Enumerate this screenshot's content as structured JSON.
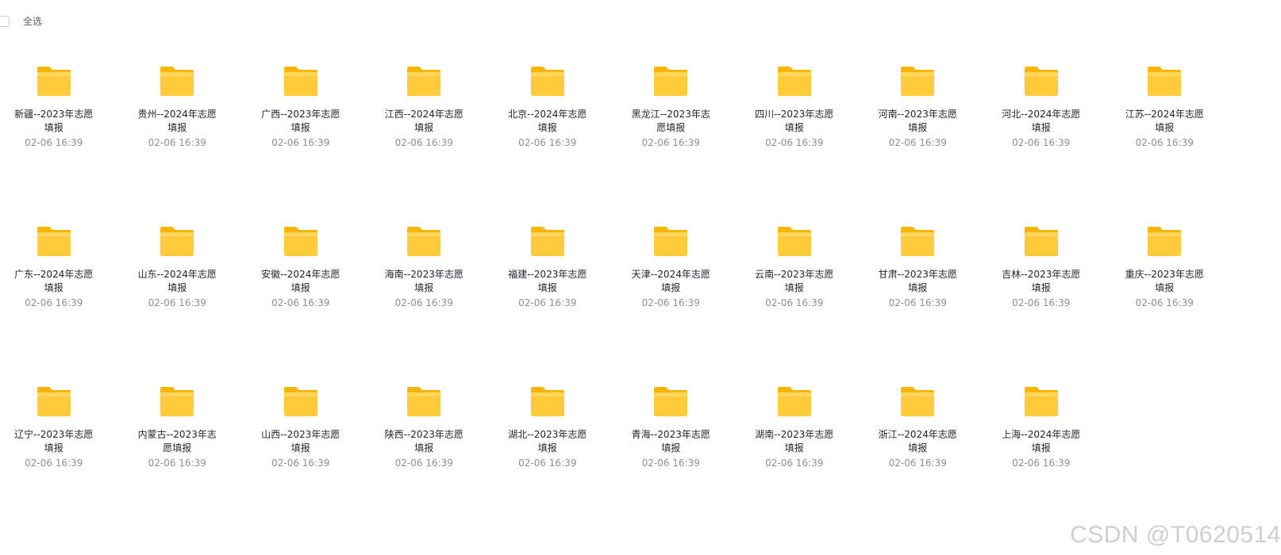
{
  "toolbar": {
    "select_all_label": "全选"
  },
  "folders": [
    {
      "name": "新疆--2023年志愿填报",
      "date": "02-06 16:39"
    },
    {
      "name": "贵州--2024年志愿填报",
      "date": "02-06 16:39"
    },
    {
      "name": "广西--2023年志愿填报",
      "date": "02-06 16:39"
    },
    {
      "name": "江西--2024年志愿填报",
      "date": "02-06 16:39"
    },
    {
      "name": "北京--2024年志愿填报",
      "date": "02-06 16:39"
    },
    {
      "name": "黑龙江--2023年志愿填报",
      "date": "02-06 16:39"
    },
    {
      "name": "四川--2023年志愿填报",
      "date": "02-06 16:39"
    },
    {
      "name": "河南--2023年志愿填报",
      "date": "02-06 16:39"
    },
    {
      "name": "河北--2024年志愿填报",
      "date": "02-06 16:39"
    },
    {
      "name": "江苏--2024年志愿填报",
      "date": "02-06 16:39"
    },
    {
      "name": "广东--2024年志愿填报",
      "date": "02-06 16:39"
    },
    {
      "name": "山东--2024年志愿填报",
      "date": "02-06 16:39"
    },
    {
      "name": "安徽--2024年志愿填报",
      "date": "02-06 16:39"
    },
    {
      "name": "海南--2023年志愿填报",
      "date": "02-06 16:39"
    },
    {
      "name": "福建--2023年志愿填报",
      "date": "02-06 16:39"
    },
    {
      "name": "天津--2024年志愿填报",
      "date": "02-06 16:39"
    },
    {
      "name": "云南--2023年志愿填报",
      "date": "02-06 16:39"
    },
    {
      "name": "甘肃--2023年志愿填报",
      "date": "02-06 16:39"
    },
    {
      "name": "吉林--2023年志愿填报",
      "date": "02-06 16:39"
    },
    {
      "name": "重庆--2023年志愿填报",
      "date": "02-06 16:39"
    },
    {
      "name": "辽宁--2023年志愿填报",
      "date": "02-06 16:39"
    },
    {
      "name": "内蒙古--2023年志愿填报",
      "date": "02-06 16:39"
    },
    {
      "name": "山西--2023年志愿填报",
      "date": "02-06 16:39"
    },
    {
      "name": "陕西--2023年志愿填报",
      "date": "02-06 16:39"
    },
    {
      "name": "湖北--2023年志愿填报",
      "date": "02-06 16:39"
    },
    {
      "name": "青海--2023年志愿填报",
      "date": "02-06 16:39"
    },
    {
      "name": "湖南--2023年志愿填报",
      "date": "02-06 16:39"
    },
    {
      "name": "浙江--2024年志愿填报",
      "date": "02-06 16:39"
    },
    {
      "name": "上海--2024年志愿填报",
      "date": "02-06 16:39"
    }
  ],
  "icons": {
    "folder": "folder-icon"
  },
  "colors": {
    "folder_back": "#F7B500",
    "folder_front": "#FFCB3A",
    "date_text": "#8A8F99"
  },
  "watermark": "CSDN @T0620514"
}
